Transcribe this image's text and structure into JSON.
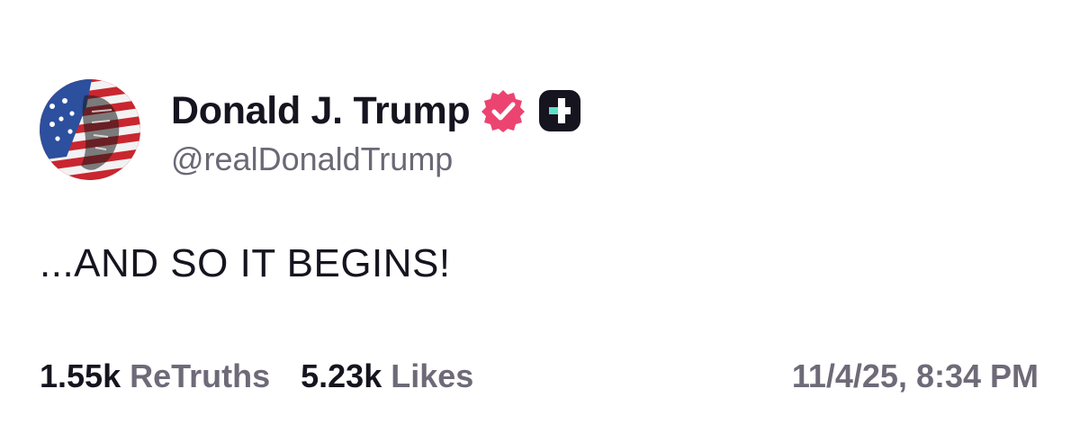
{
  "post": {
    "author": {
      "display_name": "Donald J. Trump",
      "handle": "@realDonaldTrump",
      "verified_icon": "verified-badge-icon",
      "plus_icon": "truth-plus-badge-icon",
      "verified_color": "#ec4470",
      "plus_badge_bg": "#16141f",
      "plus_badge_accent": "#5fe0c6"
    },
    "text": "...AND SO IT BEGINS!",
    "stats": {
      "retruths_count": "1.55k",
      "retruths_label": "ReTruths",
      "likes_count": "5.23k",
      "likes_label": "Likes"
    },
    "timestamp": "11/4/25, 8:34 PM"
  }
}
